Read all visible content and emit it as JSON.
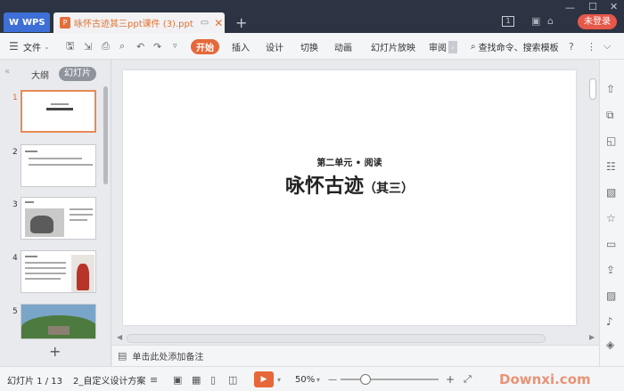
{
  "titlebar": {
    "app_label": "WPS",
    "doc_tab": "咏怀古迹其三ppt课件 (3).ppt",
    "new_tab": "+",
    "login_label": "未登录",
    "badge": "1"
  },
  "ribbon": {
    "file_label": "文件",
    "tabs": [
      "开始",
      "插入",
      "设计",
      "切换",
      "动画",
      "幻灯片放映",
      "审阅"
    ],
    "search_label": "查找命令、搜索模板"
  },
  "left_panel": {
    "outline_tab": "大纲",
    "slides_tab": "幻灯片",
    "slide_numbers": [
      "1",
      "2",
      "3",
      "4",
      "5"
    ],
    "add_label": "+"
  },
  "slide": {
    "subtitle": "第二单元 • 阅读",
    "title": "咏怀古迹",
    "title_suffix": "（其三）"
  },
  "notes": {
    "placeholder": "单击此处添加备注"
  },
  "statusbar": {
    "slide_counter": "幻灯片 1 / 13",
    "theme": "2_自定义设计方案",
    "zoom": "50%",
    "watermark": "Downxi.com"
  },
  "colors": {
    "accent": "#e6683a",
    "titlebar": "#2c3443",
    "wps_blue": "#3d6fd6",
    "login": "#e5584a"
  }
}
